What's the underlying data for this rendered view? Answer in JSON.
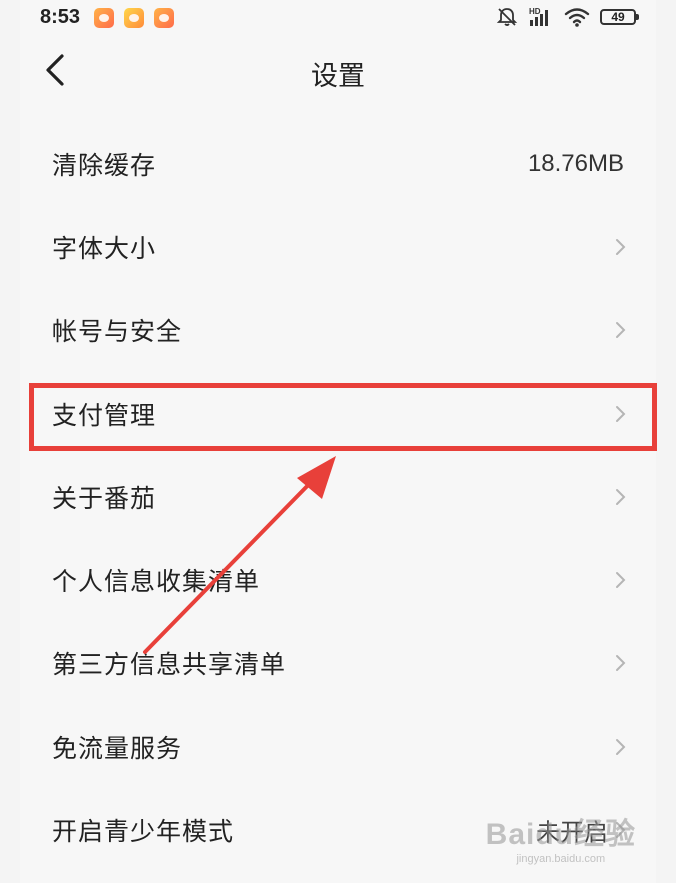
{
  "status_bar": {
    "time": "8:53",
    "battery": "49",
    "network_label": "HD"
  },
  "header": {
    "title": "设置"
  },
  "settings": {
    "items": [
      {
        "label": "清除缓存",
        "value": "18.76MB",
        "has_chevron": false
      },
      {
        "label": "字体大小",
        "value": "",
        "has_chevron": true
      },
      {
        "label": "帐号与安全",
        "value": "",
        "has_chevron": true
      },
      {
        "label": "支付管理",
        "value": "",
        "has_chevron": true
      },
      {
        "label": "关于番茄",
        "value": "",
        "has_chevron": true
      },
      {
        "label": "个人信息收集清单",
        "value": "",
        "has_chevron": true
      },
      {
        "label": "第三方信息共享清单",
        "value": "",
        "has_chevron": true
      },
      {
        "label": "免流量服务",
        "value": "",
        "has_chevron": true
      },
      {
        "label": "开启青少年模式",
        "value": "未开启",
        "has_chevron": true
      }
    ]
  },
  "watermark": {
    "logo": "Baidu经验",
    "url": "jingyan.baidu.com"
  },
  "colors": {
    "annotation": "#e8403a",
    "background": "#f7f7f7",
    "text": "#222222"
  }
}
